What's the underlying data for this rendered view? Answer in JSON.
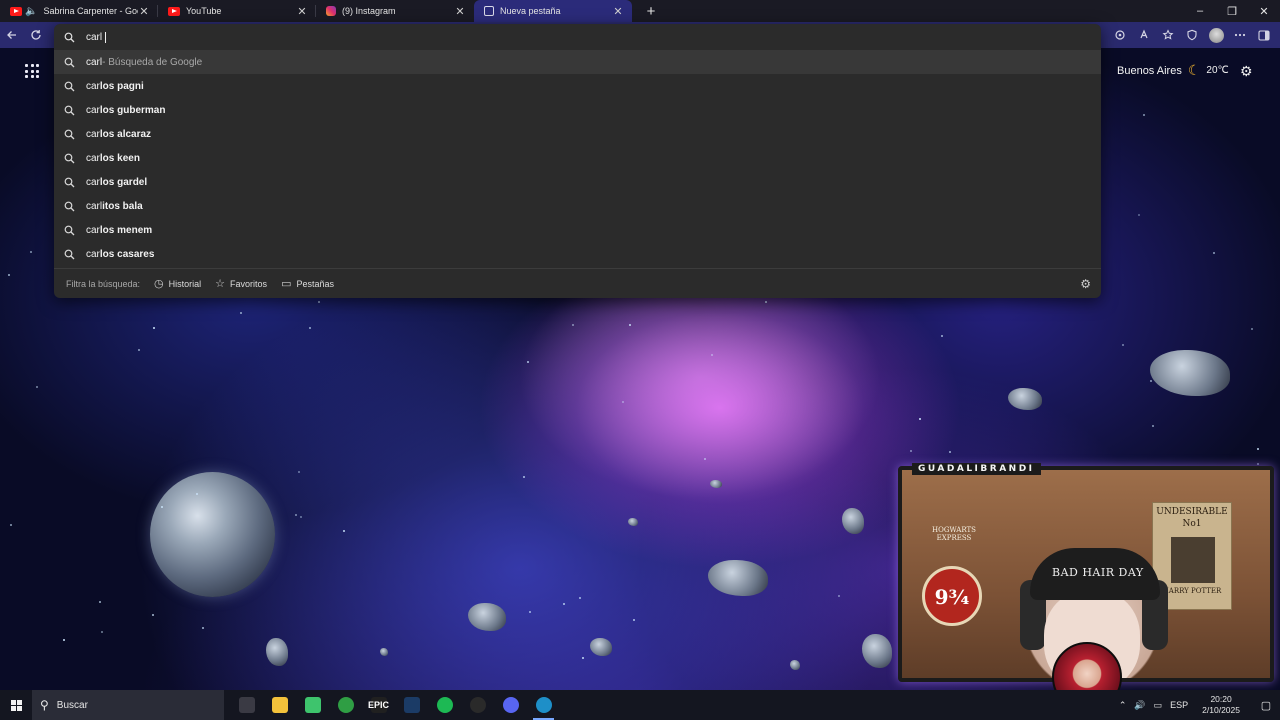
{
  "tabs": [
    {
      "title": "Sabrina Carpenter - Goodbye",
      "favicon": "youtube-icon",
      "audio": true,
      "active": false
    },
    {
      "title": "YouTube",
      "favicon": "youtube-icon",
      "audio": false,
      "active": false
    },
    {
      "title": "(9) Instagram",
      "favicon": "instagram-icon",
      "audio": false,
      "active": false
    },
    {
      "title": "Nueva pestaña",
      "favicon": "page-icon",
      "audio": false,
      "active": true
    }
  ],
  "tab_close_glyph": "✕",
  "new_tab_glyph": "+",
  "window_controls": {
    "minimize": "–",
    "restore": "❐",
    "close": "✕"
  },
  "omnibox": {
    "query": "carl",
    "suggestions": [
      {
        "prefix": "carl",
        "rest": "",
        "hint": " - Búsqueda de Google"
      },
      {
        "prefix": "car",
        "rest": "los pagni",
        "hint": ""
      },
      {
        "prefix": "car",
        "rest": "los guberman",
        "hint": ""
      },
      {
        "prefix": "car",
        "rest": "los alcaraz",
        "hint": ""
      },
      {
        "prefix": "car",
        "rest": "los keen",
        "hint": ""
      },
      {
        "prefix": "car",
        "rest": "los gardel",
        "hint": ""
      },
      {
        "prefix": "carl",
        "rest": "itos bala",
        "hint": ""
      },
      {
        "prefix": "car",
        "rest": "los menem",
        "hint": ""
      },
      {
        "prefix": "car",
        "rest": "los casares",
        "hint": ""
      }
    ],
    "filter_label": "Filtra la búsqueda:",
    "filters": [
      {
        "label": "Historial",
        "icon": "history-icon",
        "glyph": "◷"
      },
      {
        "label": "Favoritos",
        "icon": "star-icon",
        "glyph": "☆"
      },
      {
        "label": "Pestañas",
        "icon": "tabs-icon",
        "glyph": "▭"
      }
    ]
  },
  "weather": {
    "city": "Buenos Aires",
    "icon": "moon-icon",
    "temp": "20℃"
  },
  "webcam": {
    "channel": "GUADALIBRANDI",
    "beanie_text": "BAD HAIR DAY",
    "poster_line1": "UNDESIRABLE",
    "poster_line2": "No1",
    "poster_line3": "HARRY POTTER",
    "sign_text": "9¾",
    "sign_top": "HOGWARTS EXPRESS"
  },
  "taskbar": {
    "search_placeholder": "Buscar",
    "language": "ESP",
    "time": "20:20",
    "date": "2/10/2025",
    "apps": [
      {
        "name": "task-view",
        "label": "",
        "color": "#3a3a44"
      },
      {
        "name": "file-explorer",
        "label": "",
        "color": "#f3c23b"
      },
      {
        "name": "widgets-app",
        "label": "",
        "color": "#3ec46d"
      },
      {
        "name": "xbox",
        "label": "",
        "color": "#2f9e44"
      },
      {
        "name": "epic-games",
        "label": "EPIC",
        "color": "#202020"
      },
      {
        "name": "steam",
        "label": "",
        "color": "#1b3b66"
      },
      {
        "name": "spotify",
        "label": "",
        "color": "#1db954"
      },
      {
        "name": "obs",
        "label": "",
        "color": "#2a2a2a"
      },
      {
        "name": "discord",
        "label": "",
        "color": "#5865f2"
      },
      {
        "name": "edge",
        "label": "",
        "color": "#1e8fc8"
      }
    ]
  }
}
